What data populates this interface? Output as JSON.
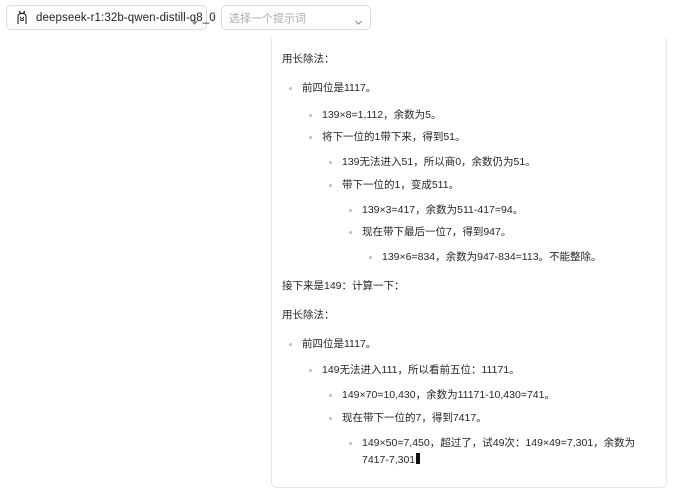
{
  "header": {
    "model_name": "deepseek-r1:32b-qwen-distill-q8_0",
    "separator": "/",
    "prompt_placeholder": "选择一个提示词"
  },
  "content": {
    "p1": "用长除法：",
    "l1": "前四位是1117。",
    "l2": "139×8=1,112，余数为5。",
    "l3": "将下一位的1带下来，得到51。",
    "l4": "139无法进入51，所以商0，余数仍为51。",
    "l5": "带下一位的1，变成511。",
    "l6": "139×3=417，余数为511-417=94。",
    "l7": "现在带下最后一位7，得到947。",
    "l8": "139×6=834，余数为947-834=113。不能整除。",
    "p2": "接下来是149：计算一下：",
    "p3": "用长除法：",
    "l9": "前四位是1117。",
    "l10": "149无法进入111，所以看前五位：11171。",
    "l11": "149×70=10,430，余数为11171-10,430=741。",
    "l12": "现在带下一位的7，得到7417。",
    "l13a": "149×50=7,450，超过了，试49次：149×49=7,301，余数为",
    "l13b": "7417-7,301"
  }
}
